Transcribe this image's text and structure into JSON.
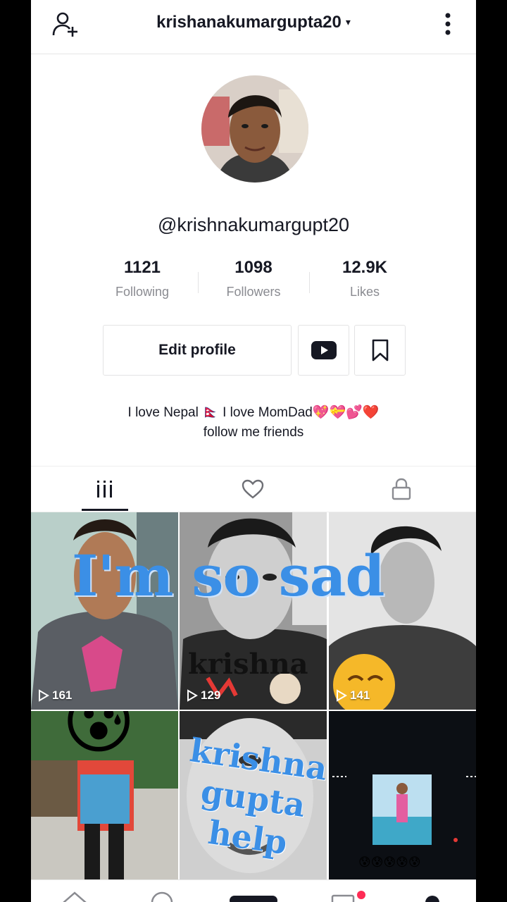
{
  "header": {
    "username": "krishanakumargupta20",
    "caret": "▾"
  },
  "profile": {
    "handle": "@krishnakumargupt20",
    "stats": [
      {
        "value": "1121",
        "label": "Following"
      },
      {
        "value": "1098",
        "label": "Followers"
      },
      {
        "value": "12.9K",
        "label": "Likes"
      }
    ],
    "edit_label": "Edit profile",
    "bio_line1": "I love Nepal 🇳🇵 I love MomDad💖💝💕❤️",
    "bio_line2": "follow me friends"
  },
  "tabs": [
    "videos-tab",
    "liked-tab",
    "private-tab"
  ],
  "videos": [
    {
      "views": "161"
    },
    {
      "views": "129",
      "caption": "krishna"
    },
    {
      "views": "141"
    },
    {
      "views": ""
    },
    {
      "views": "",
      "caption": "krishna gupta help"
    },
    {
      "views": "",
      "caption": "😰😰😰😰😰"
    }
  ],
  "overlay_text": "I'm so sad",
  "cell5_lines": [
    "krishna",
    "gupta",
    "help"
  ],
  "emoji_scared": "😰",
  "emoji_smile": "😊"
}
